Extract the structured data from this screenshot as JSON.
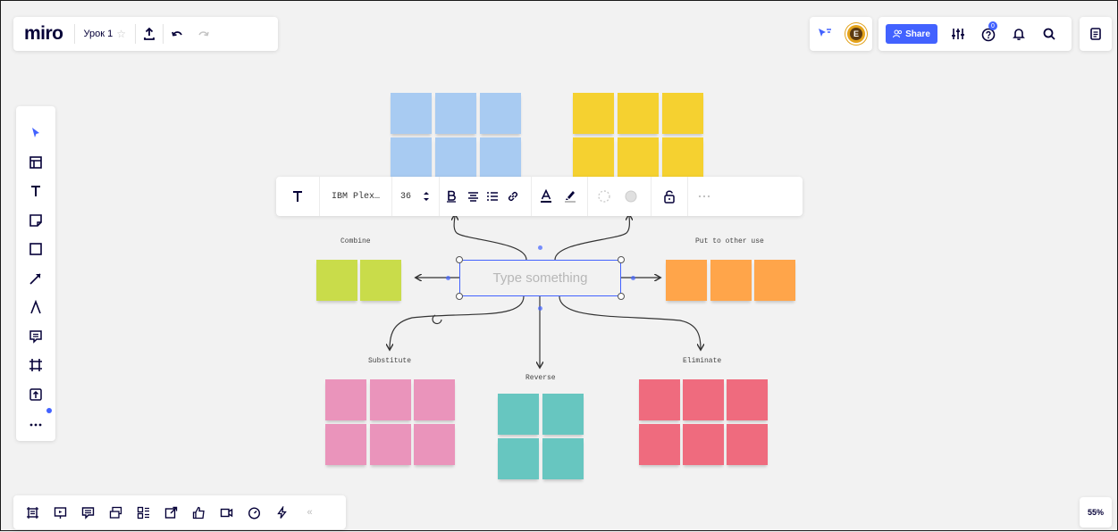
{
  "app": {
    "logo": "miro",
    "board_name": "Урок 1",
    "star": "☆"
  },
  "top_right": {
    "avatar_letter": "E",
    "share_label": "Share",
    "help_badge_count": "0"
  },
  "left_toolbar": {
    "items": [
      "select-cursor-icon",
      "templates-icon",
      "text-icon",
      "sticky-note-icon",
      "shape-icon",
      "arrow-line-icon",
      "pen-icon",
      "comment-icon",
      "frame-icon",
      "upload-icon",
      "more-icon"
    ]
  },
  "bottom_bar": {
    "items": [
      "frames-icon",
      "presentation-icon",
      "comments-icon",
      "cards-icon",
      "kanban-icon",
      "export-icon",
      "voting-icon",
      "video-chat-icon",
      "timer-icon",
      "flash-icon"
    ],
    "collapse": "«"
  },
  "zoom": {
    "level": "55%"
  },
  "text_toolbar": {
    "font_name": "IBM Plex…",
    "font_size": "36"
  },
  "canvas": {
    "center_placeholder": "Type something",
    "labels": {
      "combine": "Combine",
      "put_to_other_use": "Put to other use",
      "substitute": "Substitute",
      "reverse": "Reverse",
      "eliminate": "Eliminate"
    },
    "colors": {
      "blue": "#a8cbf2",
      "yellow": "#f5d130",
      "green": "#c9dc4a",
      "orange": "#ffa54a",
      "pink": "#ea94bb",
      "teal": "#67c6c0",
      "red": "#ef6b7e",
      "accent": "#4262ff"
    }
  }
}
